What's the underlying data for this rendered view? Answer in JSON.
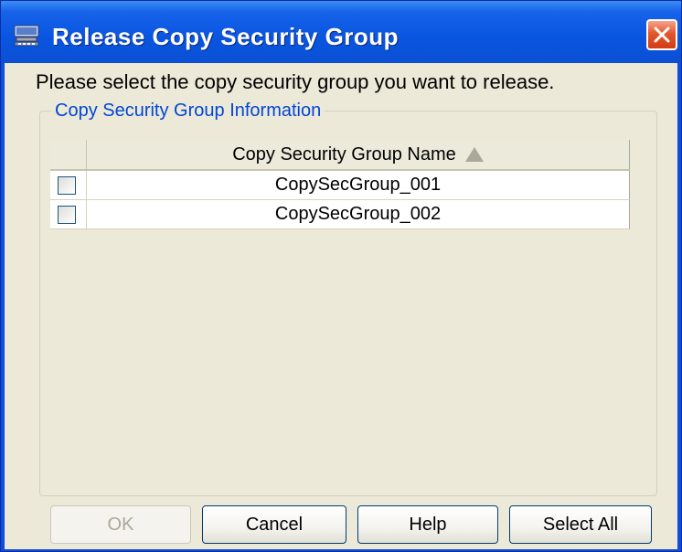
{
  "window": {
    "title": "Release Copy Security Group",
    "title_icon": "computer-network-icon",
    "close_icon": "close-icon",
    "accent_color": "#0a55e0",
    "close_color": "#d23b16"
  },
  "prompt": "Please select the copy security group you want to release.",
  "group": {
    "legend": "Copy Security Group Information"
  },
  "table": {
    "columns": [
      "Copy Security Group Name"
    ],
    "sort": "ascending",
    "rows": [
      {
        "name": "CopySecGroup_001",
        "checked": false
      },
      {
        "name": "CopySecGroup_002",
        "checked": false
      }
    ]
  },
  "buttons": {
    "ok": "OK",
    "cancel": "Cancel",
    "help": "Help",
    "select_all": "Select All",
    "ok_enabled": false
  }
}
